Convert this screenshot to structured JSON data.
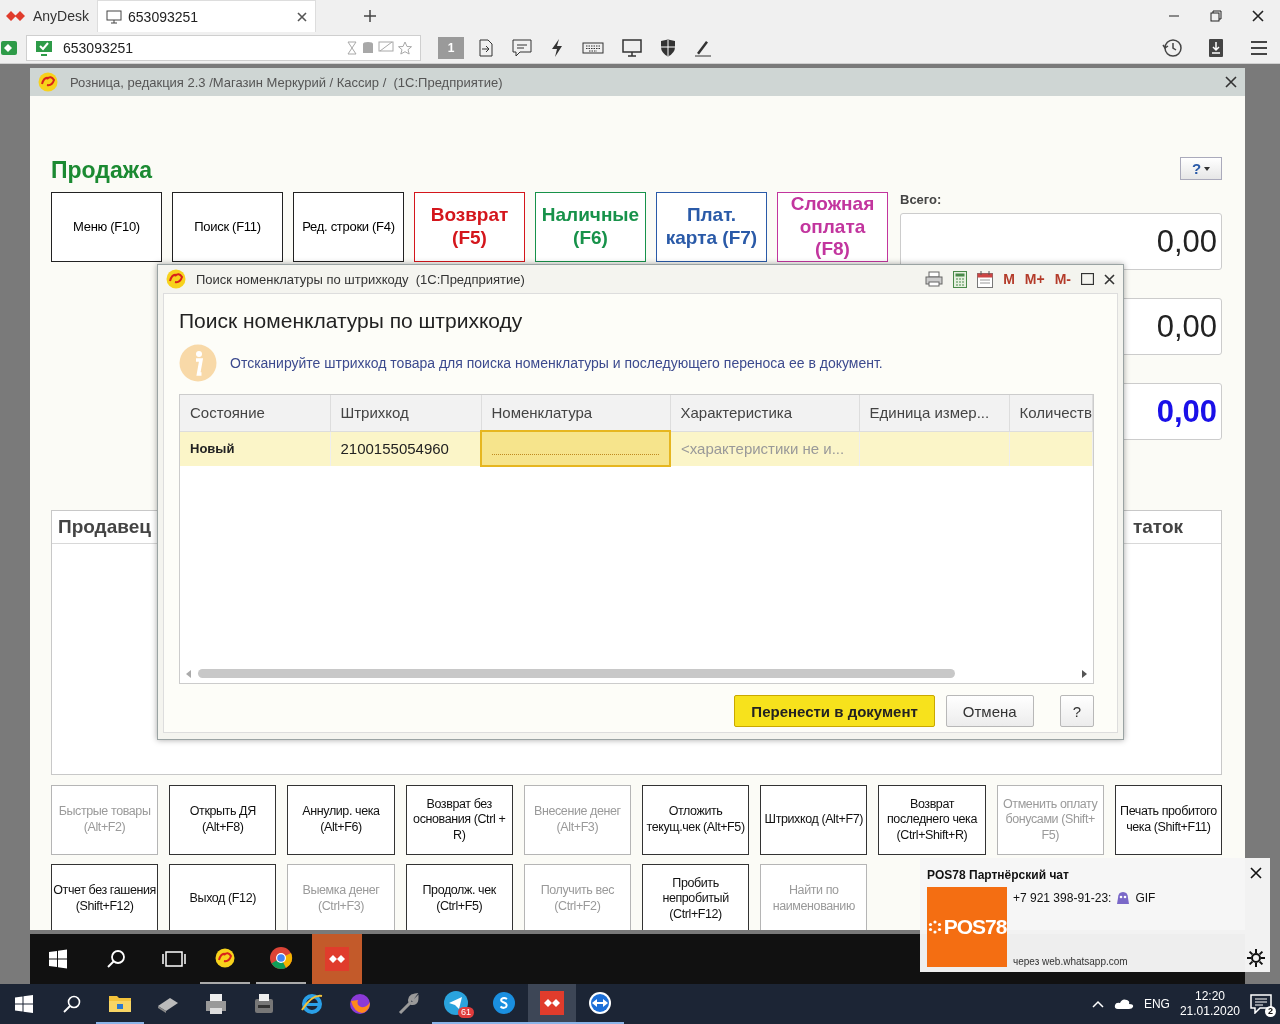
{
  "anydesk": {
    "app_name": "AnyDesk",
    "tabs": [
      {
        "label": "653093251",
        "selected": true
      }
    ],
    "address": "653093251",
    "display_number": "1"
  },
  "window": {
    "title": "Розница, редакция 2.3 /Магазин Меркурий / Кассир /  (1С:Предприятие)",
    "heading": "Продажа",
    "help_label": "?",
    "top_buttons": [
      {
        "label": "Меню (F10)",
        "kind": "small",
        "color": "#000000"
      },
      {
        "label": "Поиск (F11)",
        "kind": "small",
        "color": "#000000"
      },
      {
        "label": "Ред. строки (F4)",
        "kind": "small",
        "color": "#000000"
      },
      {
        "label": "Возврат (F5)",
        "kind": "large",
        "color": "#d4161c"
      },
      {
        "label": "Наличные (F6)",
        "kind": "large",
        "color": "#17924a"
      },
      {
        "label": "Плат. карта (F7)",
        "kind": "large",
        "color": "#2a5aa8"
      },
      {
        "label": "Сложная оплата (F8)",
        "kind": "large",
        "color": "#c2359e"
      }
    ],
    "total_label": "Всего:",
    "totals": [
      {
        "value": "0,00",
        "kind": "plain"
      },
      {
        "value": "0,00",
        "kind": "plain"
      },
      {
        "value": "0,00",
        "kind": "accent"
      }
    ],
    "panel": {
      "column_1": "Продавец",
      "column_2": "таток"
    },
    "bottom_buttons": [
      {
        "label": "Быстрые товары (Alt+F2)",
        "disabled": true
      },
      {
        "label": "Открыть ДЯ (Alt+F8)",
        "disabled": false
      },
      {
        "label": "Аннулир. чека (Alt+F6)",
        "disabled": false
      },
      {
        "label": "Возврат без основания (Ctrl + R)",
        "disabled": false
      },
      {
        "label": "Внесение денег (Alt+F3)",
        "disabled": true
      },
      {
        "label": "Отложить текущ.чек (Alt+F5)",
        "disabled": false
      },
      {
        "label": "Штрихкод (Alt+F7)",
        "disabled": false
      },
      {
        "label": "Возврат последнего чека (Ctrl+Shift+R)",
        "disabled": false
      },
      {
        "label": "Отменить оплату бонусами (Shift+ F5)",
        "disabled": true
      },
      {
        "label": "Печать пробитого чека (Shift+F11)",
        "disabled": false
      },
      {
        "label": "Отчет без гашения (Shift+F12)",
        "disabled": false
      },
      {
        "label": "Выход (F12)",
        "disabled": false
      },
      {
        "label": "Выемка денег (Ctrl+F3)",
        "disabled": true
      },
      {
        "label": "Продолж. чек (Ctrl+F5)",
        "disabled": false
      },
      {
        "label": "Получить вес (Ctrl+F2)",
        "disabled": true
      },
      {
        "label": "Пробить непробитый (Ctrl+F12)",
        "disabled": false
      },
      {
        "label": "Найти по наименованию",
        "disabled": true
      }
    ]
  },
  "dialog": {
    "title": "Поиск номенклатуры по штрихкоду  (1С:Предприятие)",
    "tool_buttons": [
      "M",
      "M+",
      "M-"
    ],
    "heading": "Поиск номенклатуры по штрихкоду",
    "info": "Отсканируйте штрихкод товара для поиска номенклатуры и последующего переноса ее в документ.",
    "columns": [
      "Состояние",
      "Штрихкод",
      "Номенклатура",
      "Характеристика",
      "Единица измер...",
      "Количеств"
    ],
    "rows": [
      {
        "selected": true,
        "cells": [
          {
            "text": "Новый",
            "kind": "bold",
            "focused": false
          },
          {
            "text": "2100155054960",
            "kind": "plain",
            "focused": false
          },
          {
            "kind": "input",
            "focused": true
          },
          {
            "text": "<характеристики не и...",
            "kind": "hint",
            "focused": false
          },
          {
            "kind": "plain",
            "focused": false
          },
          {
            "kind": "plain",
            "focused": false
          }
        ]
      }
    ],
    "buttons": [
      {
        "label": "Перенести в документ",
        "kind": "default"
      },
      {
        "label": "Отмена",
        "kind": "normal"
      },
      {
        "label": "?",
        "kind": "normal"
      }
    ]
  },
  "notification": {
    "title": "POS78 Партнёрский чат",
    "logo_text": "POS78",
    "sender": "+7 921 398-91-23:",
    "attachment": "GIF",
    "via": "через web.whatsapp.com"
  },
  "remote_taskbar": {
    "apps": [
      {
        "kind": "onec",
        "selected": false
      },
      {
        "kind": "chrome",
        "selected": false
      },
      {
        "kind": "anydesk",
        "selected": true
      }
    ]
  },
  "taskbar": {
    "apps": [
      {
        "kind": "folder",
        "running": true,
        "selected": false
      },
      {
        "kind": "scanner",
        "running": false,
        "selected": false
      },
      {
        "kind": "printer",
        "running": false,
        "selected": false
      },
      {
        "kind": "receipt-printer",
        "running": false,
        "selected": false
      },
      {
        "kind": "ie",
        "running": false,
        "selected": false
      },
      {
        "kind": "firefox",
        "running": false,
        "selected": false
      },
      {
        "kind": "wrench",
        "running": false,
        "selected": false
      },
      {
        "kind": "telegram",
        "running": true,
        "selected": false,
        "badge": "61"
      },
      {
        "kind": "skype",
        "running": true,
        "selected": false
      },
      {
        "kind": "anydesk",
        "running": true,
        "selected": true
      },
      {
        "kind": "teamviewer",
        "running": true,
        "selected": false
      }
    ],
    "language": "ENG",
    "time": "12:20",
    "date": "21.01.2020",
    "notification_count": "2"
  }
}
